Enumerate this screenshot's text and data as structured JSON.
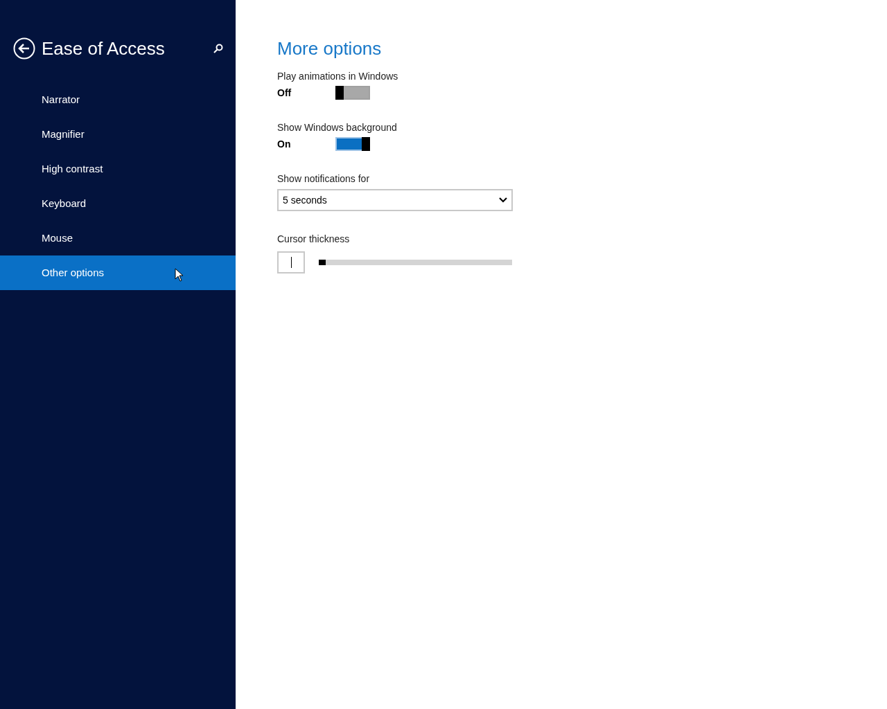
{
  "sidebar": {
    "title": "Ease of Access",
    "items": [
      {
        "label": "Narrator",
        "selected": false
      },
      {
        "label": "Magnifier",
        "selected": false
      },
      {
        "label": "High contrast",
        "selected": false
      },
      {
        "label": "Keyboard",
        "selected": false
      },
      {
        "label": "Mouse",
        "selected": false
      },
      {
        "label": "Other options",
        "selected": true
      }
    ]
  },
  "main": {
    "title": "More options",
    "settings": [
      {
        "kind": "toggle",
        "label": "Play animations in Windows",
        "value": "Off",
        "on": false
      },
      {
        "kind": "toggle",
        "label": "Show Windows background",
        "value": "On",
        "on": true
      },
      {
        "kind": "dropdown",
        "label": "Show notifications for",
        "value": "5 seconds"
      },
      {
        "kind": "slider",
        "label": "Cursor thickness",
        "level": 0
      }
    ]
  }
}
